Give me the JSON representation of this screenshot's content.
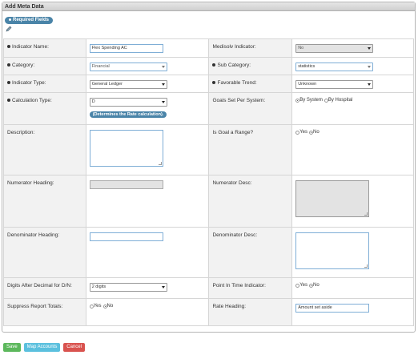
{
  "panel": {
    "title": "Add Meta Data",
    "required_label": "Required Fields"
  },
  "fields": {
    "indicator_name": {
      "label": "Indicator Name:",
      "value": "Flex Spending AC"
    },
    "medisolv_indicator": {
      "label": "Medisolv Indicator:",
      "value": "No"
    },
    "category": {
      "label": "Category:",
      "value": "Financial"
    },
    "sub_category": {
      "label": "Sub Category:",
      "value": "statistics"
    },
    "indicator_type": {
      "label": "Indicator Type:",
      "value": "General Ledger"
    },
    "favorable_trend": {
      "label": "Favorable Trend:",
      "value": "Unknown"
    },
    "calculation_type": {
      "label": "Calculation Type:",
      "value": "D",
      "note": "(Determines the Rate calculation)."
    },
    "goals_set": {
      "label": "Goals Set Per System:",
      "opt1": "By System",
      "opt2": "By Hospital",
      "selected": "By System"
    },
    "description": {
      "label": "Description:"
    },
    "goal_range": {
      "label": "Is Goal a Range?",
      "opt1": "Yes",
      "opt2": "No",
      "selected": "No"
    },
    "numerator_heading": {
      "label": "Numerator Heading:"
    },
    "numerator_desc": {
      "label": "Numerator Desc:"
    },
    "denominator_heading": {
      "label": "Denominator Heading:"
    },
    "denominator_desc": {
      "label": "Denominator Desc:"
    },
    "digits_after_decimal": {
      "label": "Digits After Decimal for D/N:",
      "value": "2 digits"
    },
    "point_in_time": {
      "label": "Point In Time Indicator:",
      "opt1": "Yes",
      "opt2": "No",
      "selected": "No"
    },
    "suppress_totals": {
      "label": "Suppress Report Totals:",
      "opt1": "Yes",
      "opt2": "No",
      "selected": "No"
    },
    "rate_heading": {
      "label": "Rate Heading:",
      "value": "Amount set aside"
    }
  },
  "buttons": {
    "save": "Save",
    "map": "Map Accounts",
    "cancel": "Cancel"
  }
}
